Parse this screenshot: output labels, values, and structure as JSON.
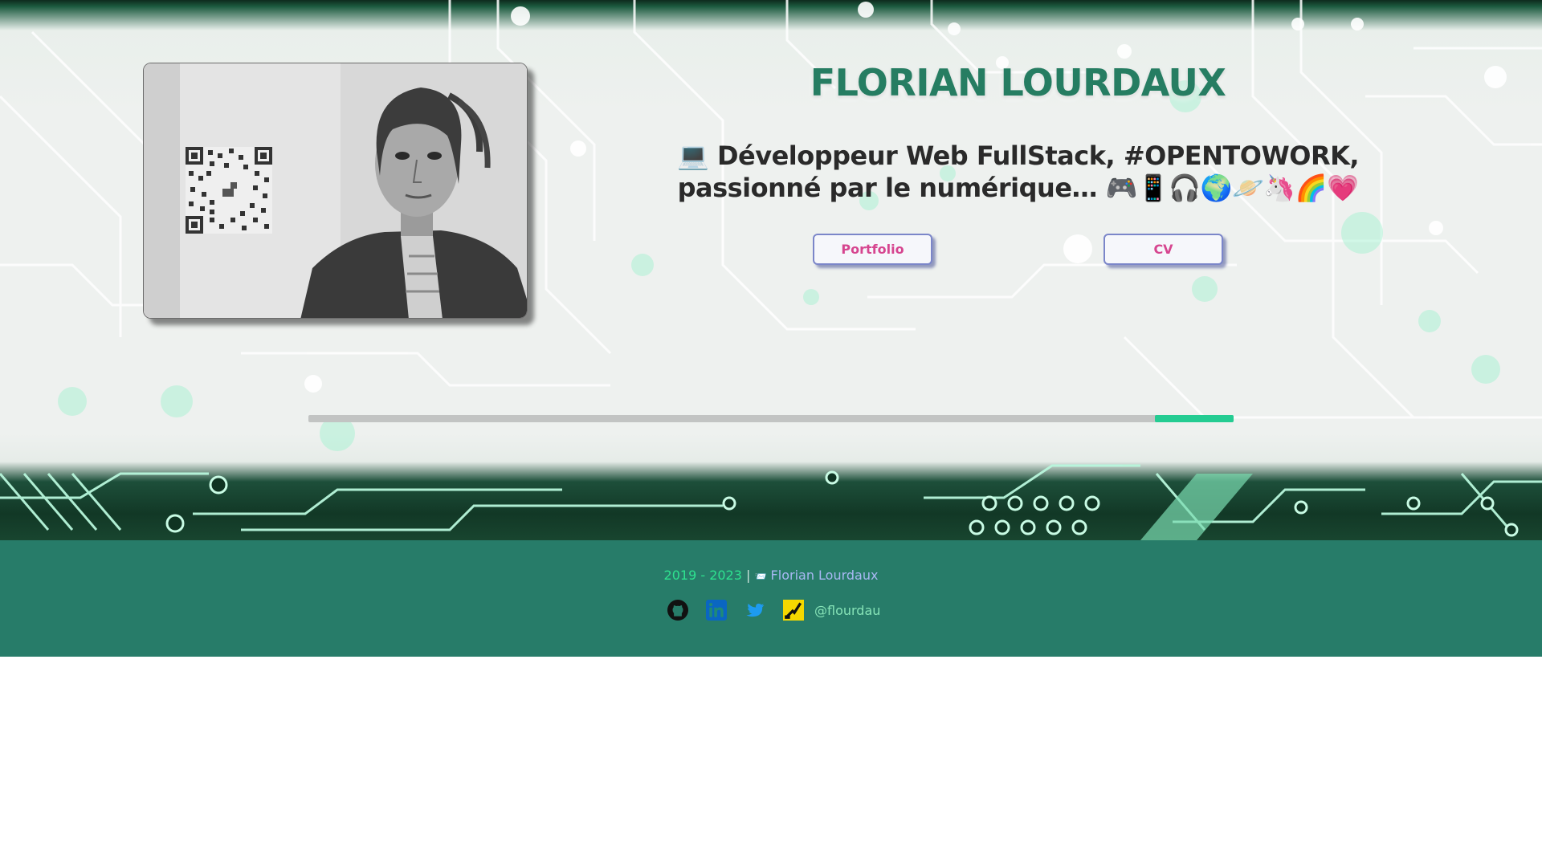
{
  "header": {
    "name": "FLORIAN LOURDAUX",
    "tagline_prefix_emoji": "💻",
    "tagline_text": "Développeur Web FullStack, #OPENTOWORK, passionné par le numérique…",
    "tagline_emojis": "🎮📱🎧🌍🪐🦄🌈💗"
  },
  "buttons": {
    "portfolio_label": "Portfolio",
    "cv_label": "CV"
  },
  "progress": {
    "start_fraction": 0.915,
    "end_fraction": 1.0
  },
  "footer": {
    "years": "2019 - 2023",
    "separator": "|",
    "mail_emoji": "📨",
    "author": "Florian Lourdaux",
    "handle": "@flourdau",
    "socials": [
      {
        "icon": "github-icon"
      },
      {
        "icon": "linkedin-icon"
      },
      {
        "icon": "twitter-icon"
      },
      {
        "icon": "root-me-icon"
      }
    ]
  },
  "colors": {
    "title": "#267d62",
    "button_text": "#d6458f",
    "button_border": "#7b86c9",
    "progress_fill": "#24cc92",
    "footer_bg": "#277c69"
  }
}
